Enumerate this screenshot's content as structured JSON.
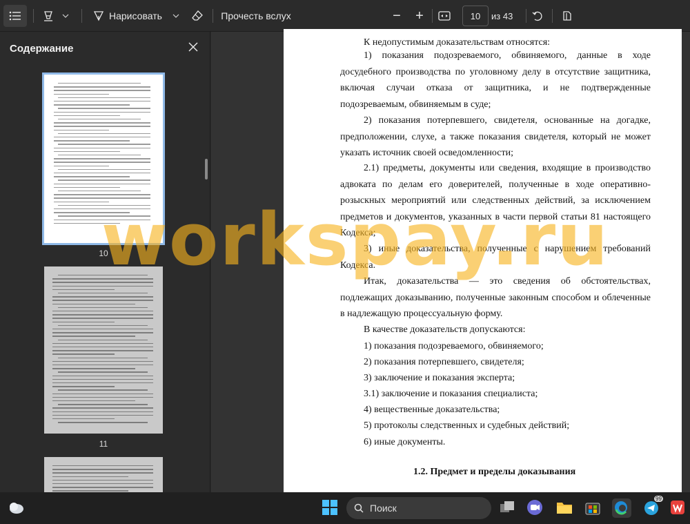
{
  "toolbar": {
    "contents_icon": "list-icon",
    "highlight_icon": "highlighter-icon",
    "draw_label": "Нарисовать",
    "eraser_icon": "eraser-icon",
    "read_aloud_label": "Прочесть вслух",
    "zoom_out": "−",
    "zoom_in": "+",
    "page_current": "10",
    "page_total": "из 43"
  },
  "sidebar": {
    "title": "Содержание",
    "thumbnails": [
      {
        "page": "10",
        "selected": true
      },
      {
        "page": "11",
        "selected": false
      },
      {
        "page": "",
        "selected": false
      }
    ]
  },
  "document": {
    "paragraphs": [
      "К недопустимым доказательствам относятся:",
      "1) показания подозреваемого, обвиняемого, данные в ходе досудебного производства по уголовному делу в отсутствие защитника, включая случаи отказа от защитника, и не подтвержденные подозреваемым, обвиняемым в суде;",
      "2) показания потерпевшего, свидетеля, основанные на догадке, предположении, слухе, а также показания свидетеля, который не может указать источник своей осведомленности;",
      "2.1) предметы, документы или сведения, входящие в производство адвоката по делам его доверителей, полученные в ходе оперативно-розыскных мероприятий или следственных действий, за исключением предметов и документов, указанных в части первой статьи 81 настоящего Кодекса;",
      "3) иные доказательства, полученные с нарушением требований Кодекса.",
      "Итак, доказательства — это сведения об обстоятельствах, подлежащих доказыванию, полученные законным способом и облеченные в надлежащую процессуальную форму.",
      "В качестве доказательств допускаются:",
      "1) показания подозреваемого, обвиняемого;",
      "2) показания потерпевшего, свидетеля;",
      "3) заключение и показания эксперта;",
      "3.1) заключение и показания специалиста;",
      "4) вещественные доказательства;",
      "5) протоколы следственных и судебных действий;",
      "6) иные документы."
    ],
    "heading": "1.2.    Предмет и пределы доказывания"
  },
  "watermark": "workspay.ru",
  "taskbar": {
    "search_placeholder": "Поиск",
    "telegram_badge": "99"
  },
  "colors": {
    "accent": "#8fb9e8",
    "watermark": "#f7b31e",
    "toolbar_bg": "#2b2b2b",
    "taskbar_bg": "#202020"
  }
}
